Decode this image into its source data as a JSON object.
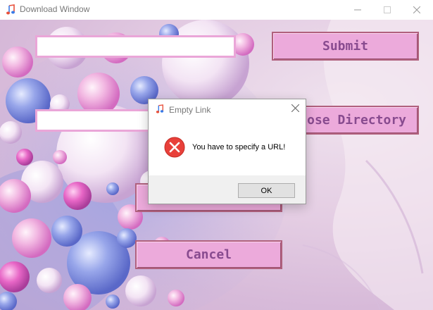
{
  "window": {
    "title": "Download Window",
    "app_icon": "music-note-icon",
    "controls": {
      "minimize": "minimize-icon",
      "maximize": "maximize-icon",
      "close": "close-icon"
    }
  },
  "form": {
    "url_value": "",
    "directory_value": "",
    "submit_label": "Submit",
    "choose_directory_label": "Choose Directory",
    "choose_directory_visible_text": "ose Directory",
    "cancel_label": "Cancel"
  },
  "dialog": {
    "title": "Empty Link",
    "message": "You have to specify a URL!",
    "ok_label": "OK",
    "icon": "error-icon"
  },
  "colors": {
    "button_fill": "#ecaadb",
    "button_text": "#884b8f",
    "button_border": "#b0607d",
    "entry_border": "#eaa6d8",
    "error_red": "#e8403a"
  }
}
